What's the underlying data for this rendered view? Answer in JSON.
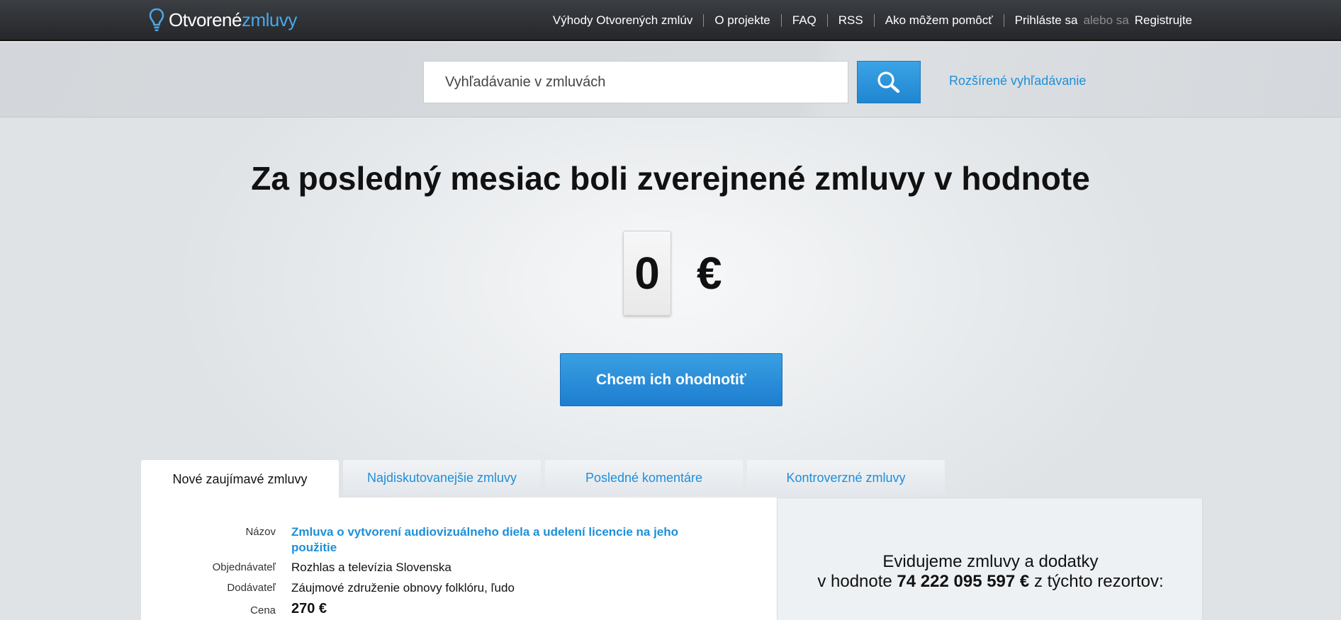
{
  "logo": {
    "part1": "Otvorené",
    "part2": "zmluvy"
  },
  "nav": {
    "items": [
      "Výhody Otvorených zmlúv",
      "O projekte",
      "FAQ",
      "RSS",
      "Ako môžem pomôcť"
    ],
    "login": "Prihláste sa",
    "or": "alebo sa",
    "register": "Registrujte"
  },
  "search": {
    "placeholder": "Vyhľadávanie v zmluvách",
    "advanced_link": "Rozšírené vyhľadávanie"
  },
  "hero": {
    "title": "Za posledný mesiac boli zverejnené zmluvy v hodnote",
    "counter_value": "0",
    "currency": "€",
    "rate_button": "Chcem ich ohodnotiť"
  },
  "tabs": [
    {
      "label": "Nové zaujímavé zmluvy",
      "active": true
    },
    {
      "label": "Najdiskutovanejšie zmluvy",
      "active": false
    },
    {
      "label": "Posledné komentáre",
      "active": false
    },
    {
      "label": "Kontroverzné zmluvy",
      "active": false
    }
  ],
  "contract": {
    "name_label": "Názov",
    "name_line1": "Zmluva o vytvorení audiovizuálneho diela a udelení licencie na jeho",
    "name_line2": "použitie",
    "orderer_label": "Objednávateľ",
    "orderer": "Rozhlas a televízia Slovenska",
    "supplier_label": "Dodávateľ",
    "supplier": "Záujmové združenie obnovy folklóru, ľudo",
    "price_label": "Cena",
    "price": "270 €"
  },
  "stats": {
    "line1": "Evidujeme zmluvy a dodatky",
    "line2_prefix": "v hodnote",
    "total": "74 222 095 597 €",
    "line2_suffix": "z týchto rezortov:"
  },
  "colors": {
    "accent": "#1e8fd8",
    "topbar": "#2e3135",
    "button": "#2a90da"
  }
}
